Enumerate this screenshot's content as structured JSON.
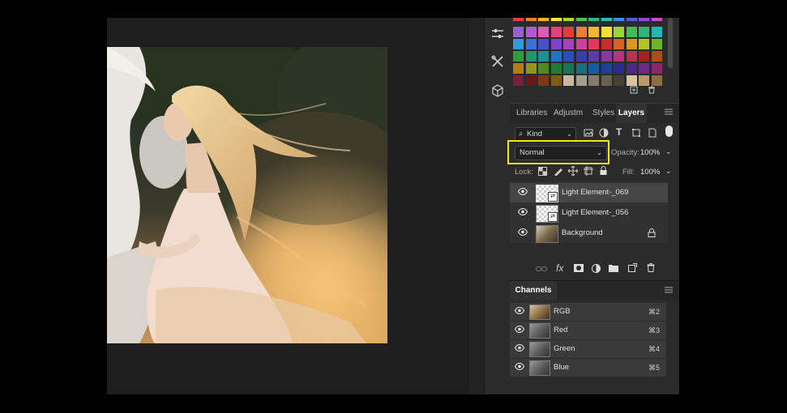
{
  "colors": {
    "accent_highlight": "#f2e51a",
    "panel_bg": "#2b2b2b"
  },
  "toolbar": {
    "tools": [
      {
        "name": "adjustments-icon",
        "glyph": "⚟"
      },
      {
        "name": "tools-icon",
        "glyph": "✂"
      },
      {
        "name": "3d-cube-icon",
        "glyph": "⬡"
      }
    ]
  },
  "swatches": {
    "rows": [
      [
        "#e8413a",
        "#f27b2d",
        "#f6b12a",
        "#f5e82e",
        "#a8d63a",
        "#52c244",
        "#36b37e",
        "#2fb8c4",
        "#3a8ee6",
        "#4a5fd8",
        "#8b4fd0",
        "#c74cc2"
      ],
      [
        "#9a5fd3",
        "#b259cf",
        "#e05bb5",
        "#e8417a",
        "#e63b3b",
        "#ef7f2e",
        "#f3b72c",
        "#f2e12e",
        "#98d43a",
        "#3fbf4e",
        "#2fb37a",
        "#27b4b3"
      ],
      [
        "#2c9de0",
        "#3a6fd9",
        "#4a4fd2",
        "#7a47c8",
        "#a443bd",
        "#d23f9c",
        "#e0375f",
        "#c72f2f",
        "#d86224",
        "#d9991f",
        "#b6c226",
        "#6bb52b"
      ],
      [
        "#2e9e3d",
        "#21946a",
        "#1e8f94",
        "#2173c2",
        "#2a4fb8",
        "#3a3bb0",
        "#5e3aa6",
        "#8a389f",
        "#b33485",
        "#b83052",
        "#9e2323",
        "#a84f1b"
      ],
      [
        "#b47d18",
        "#8f9a1c",
        "#4f8a22",
        "#1f7a32",
        "#177558",
        "#15707a",
        "#1a5aa0",
        "#213f93",
        "#2c2c8c",
        "#4a2a85",
        "#6c2a80",
        "#8a2766"
      ],
      [
        "#7a1f3c",
        "#6a1818",
        "#7c3a14",
        "#7f5a12",
        "#c8b9a4",
        "#a89c8c",
        "#857a6c",
        "#6a5f52",
        "#4a3f34",
        "#d9c3a0",
        "#b89a6e",
        "#8e6f45"
      ]
    ]
  },
  "tabs": [
    "Libraries",
    "Adjustm",
    "Styles",
    "Layers"
  ],
  "active_tab": "Layers",
  "layers_panel": {
    "filter_label": "Kind",
    "blend_mode": "Normal",
    "opacity_label": "Opacity:",
    "opacity_value": "100%",
    "lock_label": "Lock:",
    "fill_label": "Fill:",
    "fill_value": "100%",
    "layers": [
      {
        "name": "Light Element-_069",
        "type": "pattern",
        "selected": true
      },
      {
        "name": "Light Element-_056",
        "type": "pattern",
        "selected": false
      },
      {
        "name": "Background",
        "type": "photo",
        "locked": true,
        "selected": false
      }
    ]
  },
  "channels_panel": {
    "title": "Channels",
    "channels": [
      {
        "name": "RGB",
        "shortcut": "⌘2"
      },
      {
        "name": "Red",
        "shortcut": "⌘3"
      },
      {
        "name": "Green",
        "shortcut": "⌘4"
      },
      {
        "name": "Blue",
        "shortcut": "⌘5"
      }
    ]
  }
}
